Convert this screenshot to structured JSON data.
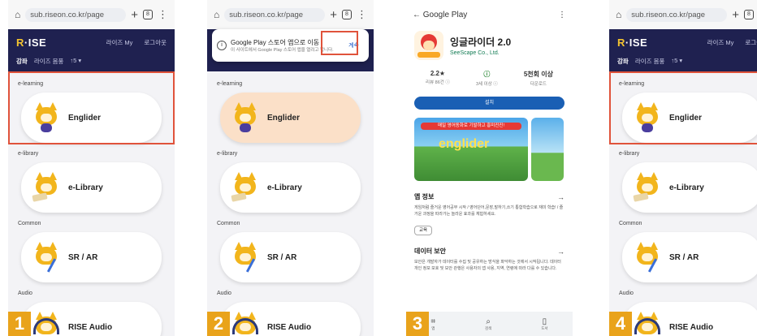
{
  "browser": {
    "url": "sub.riseon.co.kr/page",
    "url4": "sub.riseon.co.kr/page"
  },
  "rise": {
    "logo_left": "R",
    "logo_rest": "·ISE",
    "link_my": "라이즈 My",
    "link_login": "로그아웃",
    "nav_learn": "강좌",
    "nav_sub": "라이즈 몸풍",
    "nav_extra": "↑5 ▾"
  },
  "sections": [
    {
      "label": "e-learning",
      "card": "Englider"
    },
    {
      "label": "e-library",
      "card": "e-Library"
    },
    {
      "label": "Common",
      "card": "SR / AR"
    },
    {
      "label": "Audio",
      "card": "RISE Audio"
    }
  ],
  "popup": {
    "title": "Google Play 스토어 앱으로 이동",
    "sub": "이 사이트에서 Google Play 스토어 앱을 열려고 합니다.",
    "button": "계속"
  },
  "play": {
    "back": "← Google Play",
    "more": "⋮",
    "app_name": "잉글라이더 2.0",
    "developer": "SeeScape Co., Ltd.",
    "stat1_value": "2.2★",
    "stat1_label": "리뷰 86건 ⓘ",
    "stat2_value": "ⓘ",
    "stat2_label": "3세 이상 ⓘ",
    "stat3_value": "5천회 이상",
    "stat3_label": "다운로드",
    "install": "설치",
    "shot_banner": "매일 영어동화로 기발하고 흥미진진!",
    "shot_title": "englider",
    "sec1_title": "앱 정보",
    "sec1_text": "게임처럼 즐거운 영어공부 시작 / 영어단어,문장,말하기,쓰기 통합학습으로 재미 학습! / 즐거운 과정을 따라가는 놀라운 효과를 체험하세요.",
    "chip": "교육",
    "sec2_title": "데이터 보안",
    "sec2_text": "보안은 개발자가 데이터를 수집 및 공유하는 방식을 파악하는 것에서 시작됩니다. 데이터 개인 정보 보호 및 보안 관행은 사용자의 앱 사용, 지역, 연령에 따라 다를 수 있습니다.",
    "nav1": "⌗",
    "nav1_t": "앱",
    "nav2": "⌕",
    "nav2_t": "검색",
    "nav3": "▯",
    "nav3_t": "도서"
  },
  "steps": [
    "1",
    "2",
    "3",
    "4"
  ],
  "colors": {
    "header": "#1f2150",
    "highlight": "#e0533b",
    "badge": "#e9a31b",
    "peach": "#fbe0c8"
  }
}
